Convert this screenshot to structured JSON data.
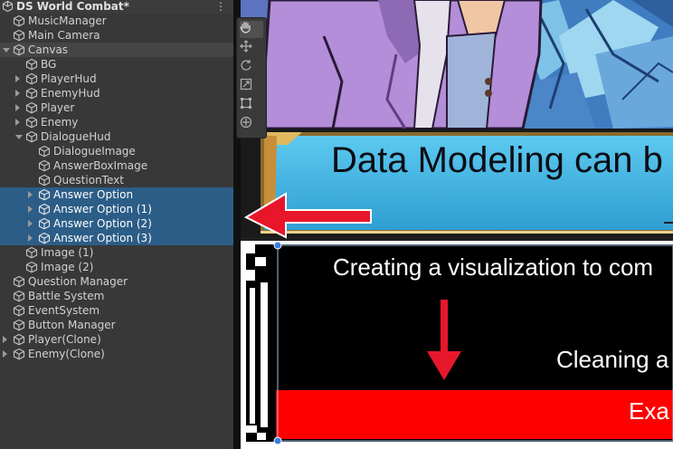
{
  "hierarchy": {
    "scene_title": "DS World Combat*",
    "menu_icon": "kebab-menu-icon",
    "items": [
      {
        "label": "MusicManager",
        "depth": 0,
        "arrow": "none",
        "selected": false
      },
      {
        "label": "Main Camera",
        "depth": 0,
        "arrow": "none",
        "selected": false
      },
      {
        "label": "Canvas",
        "depth": 0,
        "arrow": "expanded",
        "selected": false,
        "hover": true
      },
      {
        "label": "BG",
        "depth": 1,
        "arrow": "none",
        "selected": false
      },
      {
        "label": "PlayerHud",
        "depth": 1,
        "arrow": "collapsed",
        "selected": false
      },
      {
        "label": "EnemyHud",
        "depth": 1,
        "arrow": "collapsed",
        "selected": false
      },
      {
        "label": "Player",
        "depth": 1,
        "arrow": "collapsed",
        "selected": false
      },
      {
        "label": "Enemy",
        "depth": 1,
        "arrow": "collapsed",
        "selected": false
      },
      {
        "label": "DialogueHud",
        "depth": 1,
        "arrow": "expanded",
        "selected": false
      },
      {
        "label": "DialogueImage",
        "depth": 2,
        "arrow": "none",
        "selected": false
      },
      {
        "label": "AnswerBoxImage",
        "depth": 2,
        "arrow": "none",
        "selected": false
      },
      {
        "label": "QuestionText",
        "depth": 2,
        "arrow": "none",
        "selected": false
      },
      {
        "label": "Answer Option",
        "depth": 2,
        "arrow": "collapsed",
        "selected": true
      },
      {
        "label": "Answer Option (1)",
        "depth": 2,
        "arrow": "collapsed",
        "selected": true
      },
      {
        "label": "Answer Option (2)",
        "depth": 2,
        "arrow": "collapsed",
        "selected": true
      },
      {
        "label": "Answer Option (3)",
        "depth": 2,
        "arrow": "collapsed",
        "selected": true
      },
      {
        "label": "Image (1)",
        "depth": 1,
        "arrow": "none",
        "selected": false
      },
      {
        "label": "Image (2)",
        "depth": 1,
        "arrow": "none",
        "selected": false
      },
      {
        "label": "Question Manager",
        "depth": 0,
        "arrow": "none",
        "selected": false
      },
      {
        "label": "Battle System",
        "depth": 0,
        "arrow": "none",
        "selected": false
      },
      {
        "label": "EventSystem",
        "depth": 0,
        "arrow": "none",
        "selected": false
      },
      {
        "label": "Button Manager",
        "depth": 0,
        "arrow": "none",
        "selected": false
      },
      {
        "label": "Player(Clone)",
        "depth": 0,
        "arrow": "collapsed",
        "selected": false
      },
      {
        "label": "Enemy(Clone)",
        "depth": 0,
        "arrow": "collapsed",
        "selected": false
      }
    ]
  },
  "scene": {
    "title_text": "Data Modeling can b",
    "question_text": "Creating a visualization to com",
    "answer_text": "Cleaning a",
    "answer2_text": "Exa",
    "tools": [
      {
        "name": "hand-tool-icon",
        "active": true
      },
      {
        "name": "move-tool-icon",
        "active": false
      },
      {
        "name": "rotate-tool-icon",
        "active": false
      },
      {
        "name": "scale-tool-icon",
        "active": false
      },
      {
        "name": "rect-tool-icon",
        "active": false
      },
      {
        "name": "transform-tool-icon",
        "active": false
      }
    ]
  },
  "colors": {
    "hierarchy_bg": "#383838",
    "selection": "#2c5d87",
    "dialogue_blue": "#3ab0df",
    "arrow_red": "#e8162b",
    "answer_red": "#ff0000"
  }
}
